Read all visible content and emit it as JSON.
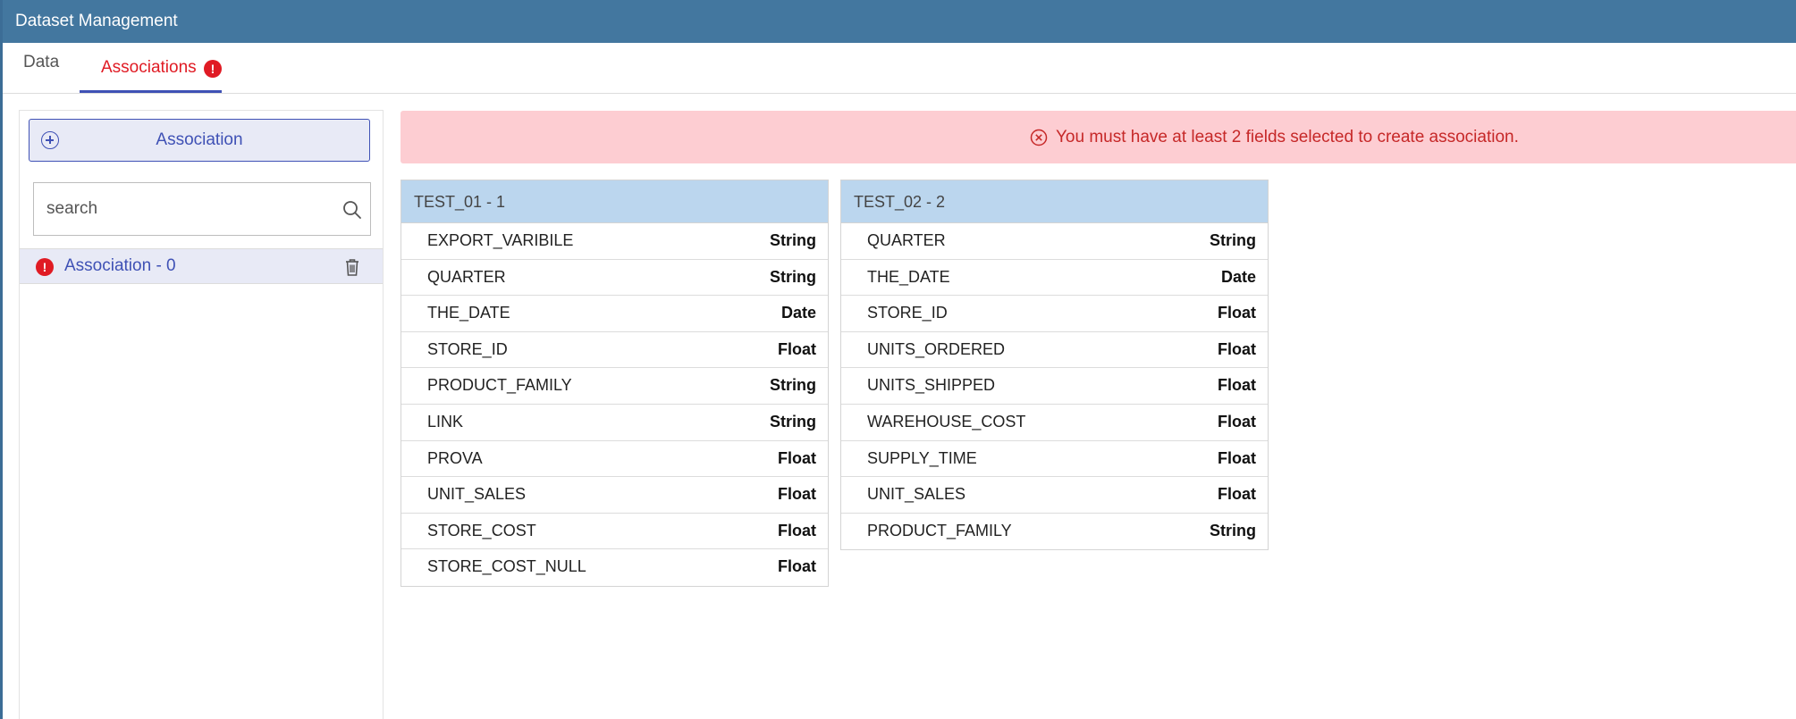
{
  "window": {
    "title": "Dataset Management"
  },
  "tabs": [
    {
      "label": "Data"
    },
    {
      "label": "Associations",
      "badge": "!"
    }
  ],
  "sidebar": {
    "add_button_label": "Association",
    "search_placeholder": "search",
    "items": [
      {
        "label": "Association - 0",
        "status": "!"
      }
    ]
  },
  "alert": {
    "message": "You must have at least 2 fields selected to create association.",
    "color": "#c62828"
  },
  "datasets": [
    {
      "title": "TEST_01 - 1",
      "fields": [
        {
          "name": "EXPORT_VARIBILE",
          "type": "String"
        },
        {
          "name": "QUARTER",
          "type": "String"
        },
        {
          "name": "THE_DATE",
          "type": "Date"
        },
        {
          "name": "STORE_ID",
          "type": "Float"
        },
        {
          "name": "PRODUCT_FAMILY",
          "type": "String"
        },
        {
          "name": "LINK",
          "type": "String"
        },
        {
          "name": "PROVA",
          "type": "Float"
        },
        {
          "name": "UNIT_SALES",
          "type": "Float"
        },
        {
          "name": "STORE_COST",
          "type": "Float"
        },
        {
          "name": "STORE_COST_NULL",
          "type": "Float"
        }
      ]
    },
    {
      "title": "TEST_02 - 2",
      "fields": [
        {
          "name": "QUARTER",
          "type": "String"
        },
        {
          "name": "THE_DATE",
          "type": "Date"
        },
        {
          "name": "STORE_ID",
          "type": "Float"
        },
        {
          "name": "UNITS_ORDERED",
          "type": "Float"
        },
        {
          "name": "UNITS_SHIPPED",
          "type": "Float"
        },
        {
          "name": "WAREHOUSE_COST",
          "type": "Float"
        },
        {
          "name": "SUPPLY_TIME",
          "type": "Float"
        },
        {
          "name": "UNIT_SALES",
          "type": "Float"
        },
        {
          "name": "PRODUCT_FAMILY",
          "type": "String"
        }
      ]
    }
  ],
  "colors": {
    "titlebar": "#43779f",
    "accent": "#3f51b5",
    "error": "#e01b24",
    "table_header": "#bbd6ee"
  }
}
